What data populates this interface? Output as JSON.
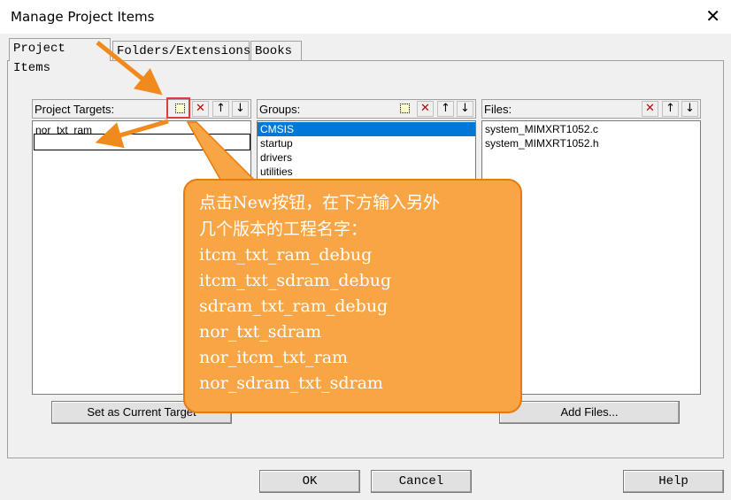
{
  "window": {
    "title": "Manage Project Items",
    "close_glyph": "✕"
  },
  "tabs": [
    {
      "label": "Project Items",
      "active": true
    },
    {
      "label": "Folders/Extensions",
      "active": false
    },
    {
      "label": "Books",
      "active": false
    }
  ],
  "project_targets": {
    "label": "Project Targets:",
    "items": [
      "nor_txt_ram"
    ],
    "new_item_value": "",
    "set_current_button": "Set as Current Target"
  },
  "groups": {
    "label": "Groups:",
    "items": [
      "CMSIS",
      "startup",
      "drivers",
      "utilities"
    ],
    "selected_index": 0
  },
  "files": {
    "label": "Files:",
    "items": [
      "system_MIMXRT1052.c",
      "system_MIMXRT1052.h"
    ],
    "add_files_button": "Add Files..."
  },
  "toolbar_icons": {
    "new": "new-item-icon",
    "delete": "delete-x-icon",
    "up": "move-up-icon",
    "down": "move-down-icon",
    "delete_glyph": "✕",
    "up_glyph": "↑",
    "down_glyph": "↓"
  },
  "footer": {
    "ok": "OK",
    "cancel": "Cancel",
    "help": "Help"
  },
  "annotation": {
    "heading_line1": "点击New按钮，在下方输入另外",
    "heading_line2": "几个版本的工程名字：",
    "names": [
      "itcm_txt_ram_debug",
      "itcm_txt_sdram_debug",
      "sdram_txt_ram_debug",
      "nor_txt_sdram",
      "nor_itcm_txt_ram",
      "nor_sdram_txt_sdram"
    ],
    "accent_color": "#f8a545",
    "highlight_color": "#e33b3b"
  }
}
